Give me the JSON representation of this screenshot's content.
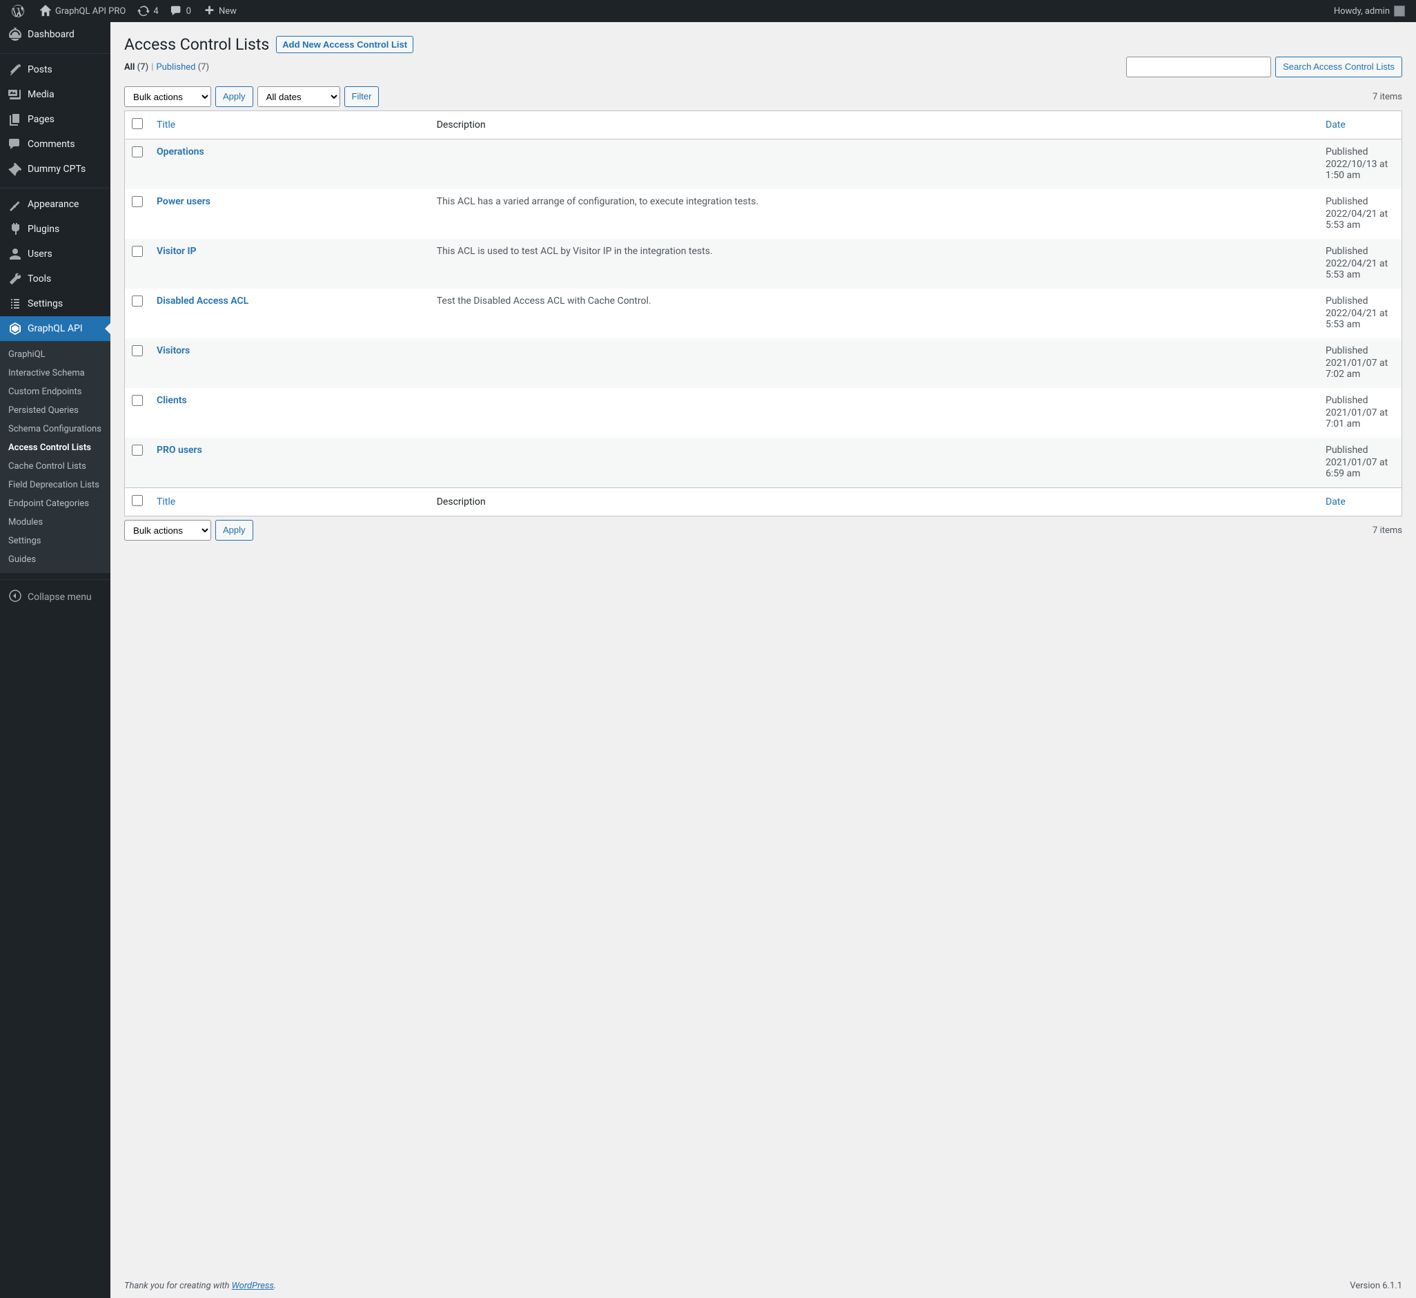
{
  "adminbar": {
    "site_name": "GraphQL API PRO",
    "updates_count": "4",
    "comments_count": "0",
    "new_label": "New",
    "howdy": "Howdy, admin"
  },
  "sidebar": {
    "items": [
      {
        "icon": "dashboard",
        "label": "Dashboard"
      },
      {
        "icon": "posts",
        "label": "Posts"
      },
      {
        "icon": "media",
        "label": "Media"
      },
      {
        "icon": "pages",
        "label": "Pages"
      },
      {
        "icon": "comments",
        "label": "Comments"
      },
      {
        "icon": "posts",
        "label": "Dummy CPTs"
      },
      {
        "icon": "appearance",
        "label": "Appearance"
      },
      {
        "icon": "plugins",
        "label": "Plugins"
      },
      {
        "icon": "users",
        "label": "Users"
      },
      {
        "icon": "tools",
        "label": "Tools"
      },
      {
        "icon": "settings",
        "label": "Settings"
      },
      {
        "icon": "graphql",
        "label": "GraphQL API"
      }
    ],
    "submenu": [
      {
        "label": "GraphiQL"
      },
      {
        "label": "Interactive Schema"
      },
      {
        "label": "Custom Endpoints"
      },
      {
        "label": "Persisted Queries"
      },
      {
        "label": "Schema Configurations"
      },
      {
        "label": "Access Control Lists"
      },
      {
        "label": "Cache Control Lists"
      },
      {
        "label": "Field Deprecation Lists"
      },
      {
        "label": "Endpoint Categories"
      },
      {
        "label": "Modules"
      },
      {
        "label": "Settings"
      },
      {
        "label": "Guides"
      }
    ],
    "collapse": "Collapse menu"
  },
  "page": {
    "title": "Access Control Lists",
    "add_new": "Add New Access Control List",
    "filters": {
      "all_label": "All",
      "all_count": "(7)",
      "published_label": "Published",
      "published_count": "(7)"
    },
    "search_button": "Search Access Control Lists",
    "bulk_actions": "Bulk actions",
    "apply_label": "Apply",
    "all_dates": "All dates",
    "filter_label": "Filter",
    "item_count": "7 items",
    "columns": {
      "title": "Title",
      "description": "Description",
      "date": "Date"
    },
    "rows": [
      {
        "title": "Operations",
        "description": "",
        "date_lines": [
          "Published",
          "2022/10/13 at 1:50 am"
        ]
      },
      {
        "title": "Power users",
        "description": "This ACL has a varied arrange of configuration, to execute integration tests.",
        "date_lines": [
          "Published",
          "2022/04/21 at 5:53 am"
        ]
      },
      {
        "title": "Visitor IP",
        "description": "This ACL is used to test ACL by Visitor IP in the integration tests.",
        "date_lines": [
          "Published",
          "2022/04/21 at 5:53 am"
        ]
      },
      {
        "title": "Disabled Access ACL",
        "description": "Test the Disabled Access ACL with Cache Control.",
        "date_lines": [
          "Published",
          "2022/04/21 at 5:53 am"
        ]
      },
      {
        "title": "Visitors",
        "description": "",
        "date_lines": [
          "Published",
          "2021/01/07 at 7:02 am"
        ]
      },
      {
        "title": "Clients",
        "description": "",
        "date_lines": [
          "Published",
          "2021/01/07 at 7:01 am"
        ]
      },
      {
        "title": "PRO users",
        "description": "",
        "date_lines": [
          "Published",
          "2021/01/07 at 6:59 am"
        ]
      }
    ]
  },
  "footer": {
    "thanks_prefix": "Thank you for creating with ",
    "wp_label": "WordPress",
    "version": "Version 6.1.1"
  }
}
